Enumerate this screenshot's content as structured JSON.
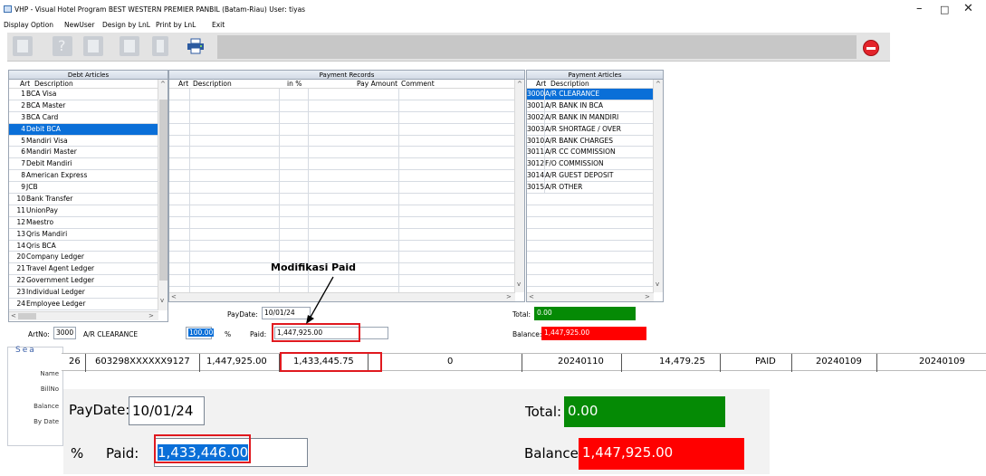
{
  "window": {
    "title": "VHP - Visual Hotel Program      BEST WESTERN PREMIER PANBIL (Batam-Riau) User: tiyas",
    "controls": [
      "–",
      "□",
      "✕"
    ]
  },
  "menu": [
    "Display Option",
    "NewUser",
    "Design by LnL",
    "Print by LnL",
    "Exit"
  ],
  "debt_articles": {
    "header": "Debt Articles",
    "col_art": "Art",
    "col_desc": "Description",
    "rows": [
      {
        "no": "1",
        "desc": "BCA Visa"
      },
      {
        "no": "2",
        "desc": "BCA Master"
      },
      {
        "no": "3",
        "desc": "BCA Card"
      },
      {
        "no": "4",
        "desc": "Debit BCA"
      },
      {
        "no": "5",
        "desc": "Mandiri Visa"
      },
      {
        "no": "6",
        "desc": "Mandiri Master"
      },
      {
        "no": "7",
        "desc": "Debit Mandiri"
      },
      {
        "no": "8",
        "desc": "American Express"
      },
      {
        "no": "9",
        "desc": "JCB"
      },
      {
        "no": "10",
        "desc": "Bank Transfer"
      },
      {
        "no": "11",
        "desc": "UnionPay"
      },
      {
        "no": "12",
        "desc": "Maestro"
      },
      {
        "no": "13",
        "desc": "Qris Mandiri"
      },
      {
        "no": "14",
        "desc": "Qris BCA"
      },
      {
        "no": "20",
        "desc": "Company Ledger"
      },
      {
        "no": "21",
        "desc": "Travel Agent Ledger"
      },
      {
        "no": "22",
        "desc": "Government Ledger"
      },
      {
        "no": "23",
        "desc": "Individual Ledger"
      },
      {
        "no": "24",
        "desc": "Employee Ledger"
      }
    ]
  },
  "payment_records": {
    "header": "Payment Records",
    "col_art": "Art",
    "col_desc": "Description",
    "col_pct": "in %",
    "col_amount": "Pay Amount",
    "col_comment": "Comment"
  },
  "payment_articles": {
    "header": "Payment Articles",
    "col_art": "Art",
    "col_desc": "Description",
    "rows": [
      {
        "no": "3000",
        "desc": "A/R CLEARANCE"
      },
      {
        "no": "3001",
        "desc": "A/R BANK IN BCA"
      },
      {
        "no": "3002",
        "desc": "A/R BANK IN MANDIRI"
      },
      {
        "no": "3003",
        "desc": "A/R SHORTAGE / OVER"
      },
      {
        "no": "3010",
        "desc": "A/R BANK CHARGES"
      },
      {
        "no": "3011",
        "desc": "A/R CC COMMISSION"
      },
      {
        "no": "3012",
        "desc": "F/O COMMISSION"
      },
      {
        "no": "3014",
        "desc": "A/R GUEST DEPOSIT"
      },
      {
        "no": "3015",
        "desc": "A/R OTHER"
      }
    ]
  },
  "form": {
    "artno_label": "ArtNo:",
    "artno_value": "3000",
    "art_name": "A/R CLEARANCE",
    "pct_value": "100.00",
    "pct_label": "%",
    "paid_label": "Paid:",
    "paid_value": "1,447,925.00",
    "paydate_label": "PayDate:",
    "paydate_value": "10/01/24",
    "total_label": "Total:",
    "total_value": "0.00",
    "balance_label": "Balance:",
    "balance_value": "1,447,925.00"
  },
  "annotation": "Modifikasi Paid",
  "search_panel": {
    "title": "Sea",
    "labels": [
      "Name",
      "BillNo",
      "Balance",
      "By Date"
    ]
  },
  "grid_row": {
    "cells": [
      "26",
      "603298XXXXXX9127",
      "1,447,925.00",
      "1,433,445.75",
      "0",
      "20240110",
      "14,479.25",
      "PAID",
      "20240109",
      "20240109"
    ]
  },
  "zoom": {
    "paydate_label": "PayDate:",
    "paydate_value": "10/01/24",
    "pct_label": "%",
    "paid_label": "Paid:",
    "paid_value": "1,433,446.00",
    "total_label": "Total:",
    "total_value": "0.00",
    "balance_label": "Balance:",
    "balance_value": "1,447,925.00"
  },
  "colors": {
    "selection": "#0a6fd8",
    "total_bg": "#058a05",
    "balance_bg": "#ff0000",
    "highlight": "#e0191f"
  }
}
